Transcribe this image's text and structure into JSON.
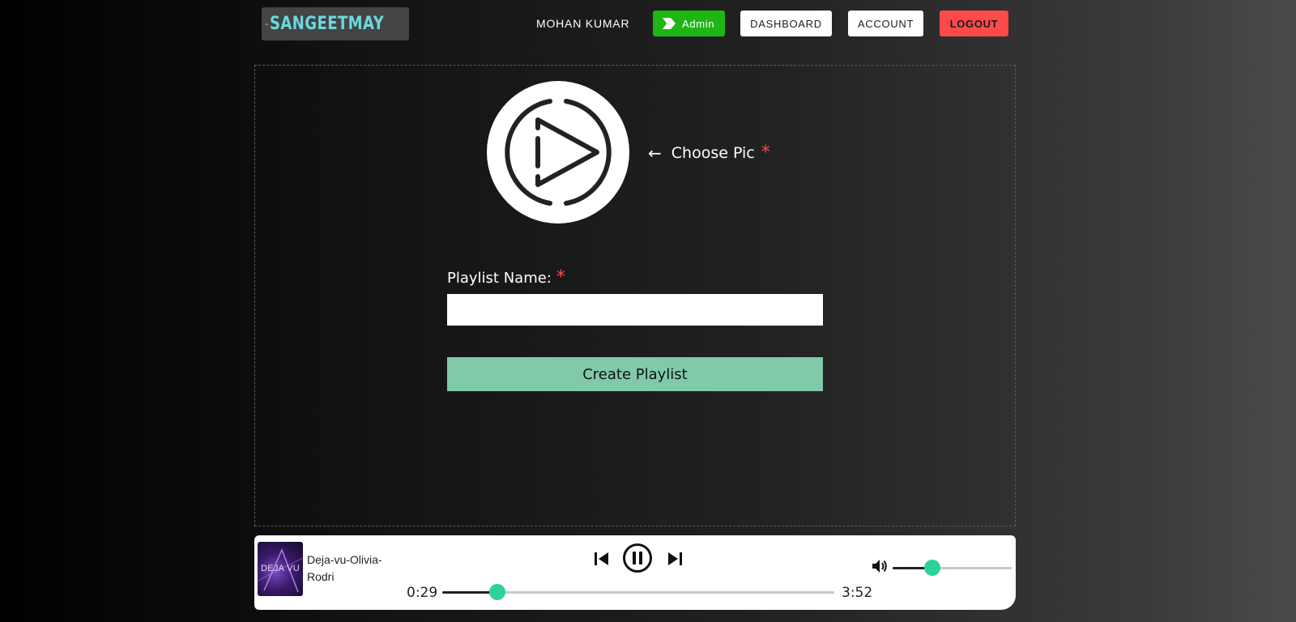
{
  "brand": {
    "name": "SANGEETMAY"
  },
  "nav": {
    "user_name": "MOHAN KUMAR",
    "admin_label": "Admin",
    "dashboard_label": "DASHBOARD",
    "account_label": "ACCOUNT",
    "logout_label": "LOGOUT"
  },
  "form": {
    "choose_pic_label": "Choose Pic",
    "required_mark": "*",
    "playlist_name_label": "Playlist Name:",
    "playlist_name_value": "",
    "create_button_label": "Create Playlist"
  },
  "player": {
    "album_art_text": "DEJA VU",
    "track_title": "Deja-vu-Olivia-Rodri",
    "current_time": "0:29",
    "total_time": "3:52",
    "progress_fraction": 0.14,
    "volume_fraction": 0.33
  },
  "colors": {
    "accent_green": "#2ed19a",
    "create_button": "#80c9a9",
    "admin_badge": "#1db614",
    "logout": "#ff4a4a",
    "brand_text": "#6ad8de"
  },
  "icons": {
    "logo": "headphones-icon",
    "admin": "arrow-tag-icon",
    "default_pic": "play-circle-icon",
    "choose_arrow": "arrow-left-icon",
    "prev": "skip-previous-icon",
    "pause": "pause-circle-icon",
    "next": "skip-next-icon",
    "volume": "volume-icon"
  }
}
